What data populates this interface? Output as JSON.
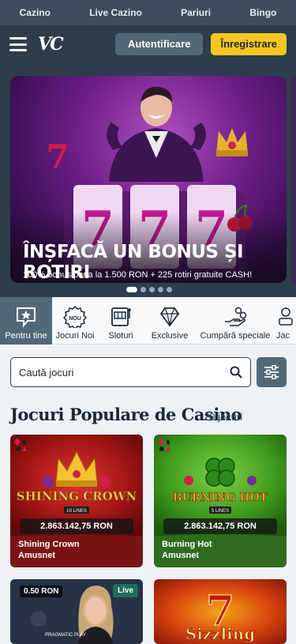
{
  "top_nav": {
    "items": [
      "Cazino",
      "Live Cazino",
      "Pariuri",
      "Bingo"
    ]
  },
  "header": {
    "logo": "VC",
    "login_label": "Autentificare",
    "register_label": "Înregistrare"
  },
  "hero": {
    "title": "ÎNȘFACĂ UN BONUS ȘI ROTIRI",
    "subtitle": "100% bonus pana la 1.500 RON + 225 rotiri gratuite CASH!",
    "slide_count": 5,
    "active_slide": 1
  },
  "categories": [
    {
      "label": "Pentru tine",
      "icon": "star-icon",
      "active": true
    },
    {
      "label": "Jocuri Noi",
      "icon": "new-badge-icon",
      "badge": "NOU",
      "active": false
    },
    {
      "label": "Sloturi",
      "icon": "slot-machine-icon",
      "active": false
    },
    {
      "label": "Exclusive",
      "icon": "diamond-icon",
      "active": false
    },
    {
      "label": "Cumpără speciale",
      "icon": "hand-coins-icon",
      "active": false
    },
    {
      "label": "Jac",
      "icon": "jackpot-icon",
      "active": false
    }
  ],
  "search": {
    "placeholder": "Caută jocuri"
  },
  "section": {
    "title": "Jocuri Populare de Casino",
    "count": "20 jocuri"
  },
  "games": [
    {
      "name": "Shining Crown",
      "provider": "Amusnet",
      "jackpot": "2.863.142,75 RON",
      "art_title": "SHINING CROWN",
      "art_sub": "10 LINES",
      "info_color": "#7a1414"
    },
    {
      "name": "Burning Hot",
      "provider": "Amusnet",
      "jackpot": "2.863.142,75 RON",
      "art_title": "BURNING HOT",
      "art_sub": "5 LINES",
      "info_color": "#2f6b1e"
    },
    {
      "bet": "0.50 RON",
      "live_badge": "Live",
      "provider_logo": "PRAGMATIC PLAY"
    },
    {
      "art_title": "Sizzling"
    }
  ],
  "colors": {
    "top_nav_bg": "#3b4d5e",
    "header_bg": "#2e3d4c",
    "accent_yellow": "#f5c622",
    "category_active_bg": "#516878"
  }
}
